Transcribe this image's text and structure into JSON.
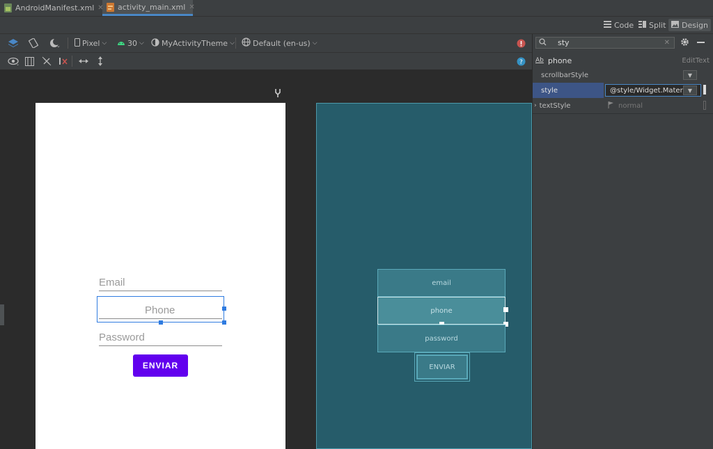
{
  "tabs": [
    {
      "label": "AndroidManifest.xml",
      "active": false
    },
    {
      "label": "activity_main.xml",
      "active": true
    }
  ],
  "view_modes": {
    "code": "Code",
    "split": "Split",
    "design": "Design",
    "selected": "Design"
  },
  "toolbar": {
    "device": "Pixel",
    "api_level": "30",
    "theme": "MyActivityTheme",
    "locale": "Default (en-us)"
  },
  "design_preview": {
    "email_hint": "Email",
    "phone_hint": "Phone",
    "password_hint": "Password",
    "button_label": "ENVIAR",
    "button_color": "#6200ee",
    "selection_color": "#2f7be0"
  },
  "blueprint": {
    "email_label": "email",
    "phone_label": "phone",
    "password_label": "password",
    "button_label": "ENVIAR",
    "background_color": "#265c6a"
  },
  "attributes_panel": {
    "search_value": "sty",
    "component_id": "phone",
    "component_type": "EditText",
    "rows": [
      {
        "name": "scrollbarStyle",
        "value": "",
        "selected": false
      },
      {
        "name": "style",
        "value": "@style/Widget.Mater",
        "selected": true
      },
      {
        "name": "textStyle",
        "value": "normal",
        "selected": false
      }
    ]
  }
}
